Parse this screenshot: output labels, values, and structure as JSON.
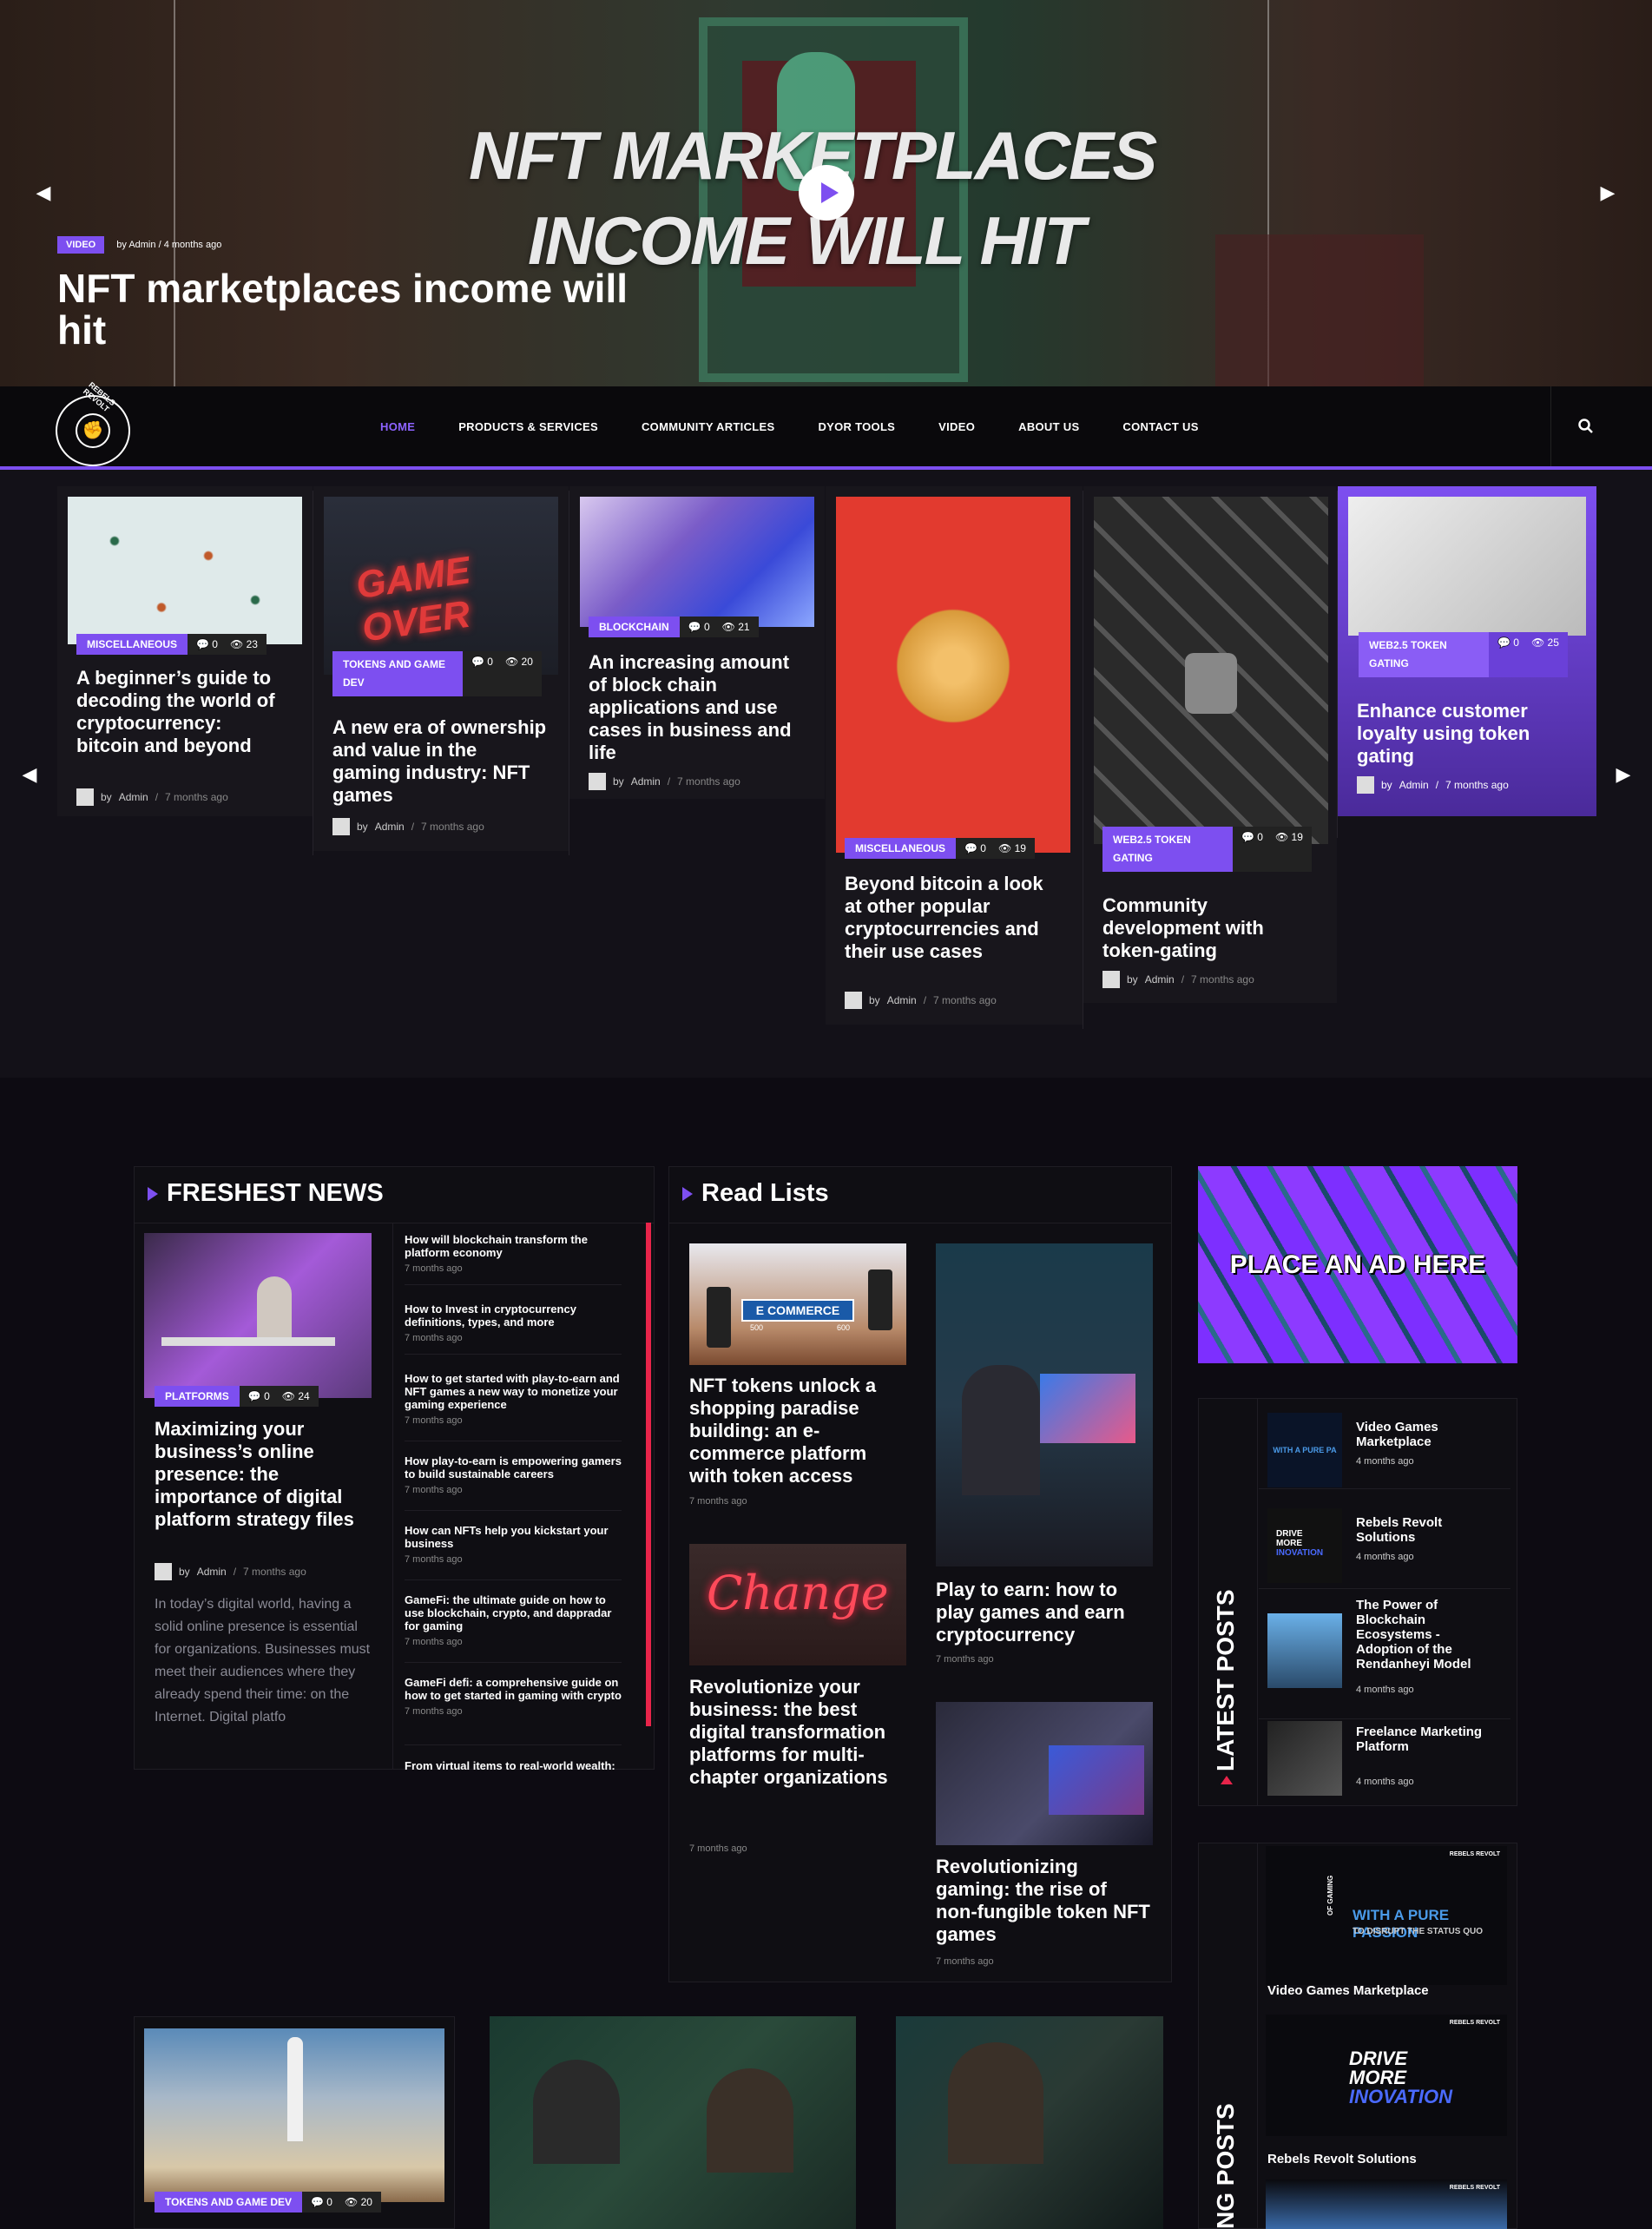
{
  "hero": {
    "overlay_line1": "NFT MARKETPLACES",
    "overlay_line2": "INCOME WILL HIT",
    "badge": "VIDEO",
    "by": "by",
    "author": "Admin",
    "sep": "/",
    "time": "4 months ago",
    "title": "NFT marketplaces income will hit"
  },
  "nav": {
    "logo_text": "REBELS REVOLT",
    "items": [
      "HOME",
      "PRODUCTS & SERVICES",
      "COMMUNITY ARTICLES",
      "DYOR TOOLS",
      "VIDEO",
      "ABOUT US",
      "CONTACT US"
    ],
    "active": "HOME"
  },
  "carousel": {
    "cards": [
      {
        "category": "MISCELLANEOUS",
        "comments": "0",
        "views": "23",
        "title": "A beginner’s guide to decoding the world of cryptocurrency: bitcoin and beyond",
        "by": "by",
        "author": "Admin",
        "time": "7 months ago"
      },
      {
        "category": "TOKENS AND GAME DEV",
        "comments": "0",
        "views": "20",
        "title": "A new era of ownership and value in the gaming industry: NFT games",
        "by": "by",
        "author": "Admin",
        "time": "7 months ago"
      },
      {
        "category": "BLOCKCHAIN",
        "comments": "0",
        "views": "21",
        "title": "An increasing amount of block chain applications and use cases in business and life",
        "by": "by",
        "author": "Admin",
        "time": "7 months ago"
      },
      {
        "category": "MISCELLANEOUS",
        "comments": "0",
        "views": "19",
        "title": "Beyond bitcoin a look at other popular cryptocurrencies and their use cases",
        "by": "by",
        "author": "Admin",
        "time": "7 months ago"
      },
      {
        "category": "WEB2.5 TOKEN GATING",
        "comments": "0",
        "views": "19",
        "title": "Community development with token-gating",
        "by": "by",
        "author": "Admin",
        "time": "7 months ago"
      },
      {
        "category": "WEB2.5 TOKEN GATING",
        "comments": "0",
        "views": "25",
        "title": "Enhance customer loyalty using token gating",
        "by": "by",
        "author": "Admin",
        "time": "7 months ago"
      }
    ]
  },
  "freshest": {
    "title": "FRESHEST NEWS",
    "featured": {
      "category": "PLATFORMS",
      "comments": "0",
      "views": "24",
      "title": "Maximizing your business’s online presence: the importance of digital platform strategy files",
      "by": "by",
      "author": "Admin",
      "time": "7 months ago",
      "excerpt": "In today’s digital world, having a solid online presence is essential for organizations. Businesses must meet their audiences where they already spend their time: on the Internet. Digital platfo"
    },
    "list": [
      {
        "title": "How will blockchain transform the platform economy",
        "time": "7 months ago"
      },
      {
        "title": "How to Invest in cryptocurrency definitions, types, and more",
        "time": "7 months ago"
      },
      {
        "title": "How to get started with play-to-earn and NFT games a new way to monetize your gaming experience",
        "time": "7 months ago"
      },
      {
        "title": "How play-to-earn is empowering gamers to build sustainable careers",
        "time": "7 months ago"
      },
      {
        "title": "How can NFTs help you kickstart your business",
        "time": "7 months ago"
      },
      {
        "title": "GameFi: the ultimate guide on how to use blockchain, crypto, and dappradar for gaming",
        "time": "7 months ago"
      },
      {
        "title": "GameFi defi: a comprehensive guide on how to get started in gaming with crypto",
        "time": "7 months ago"
      },
      {
        "title": "From virtual items to real-world wealth:",
        "time": ""
      }
    ]
  },
  "readlists": {
    "title": "Read Lists",
    "sign_text": "E COMMERCE",
    "sign_num1": "500",
    "sign_num2": "600",
    "neon_text": "Change",
    "items": [
      {
        "title": "NFT tokens unlock a shopping paradise building: an e-commerce platform with token access",
        "time": "7 months ago"
      },
      {
        "title": "Play to earn: how to play games and earn cryptocurrency",
        "time": "7 months ago"
      },
      {
        "title": "Revolutionize your business: the best digital transformation platforms for multi-chapter organizations",
        "time": "7 months ago"
      },
      {
        "title": "Revolutionizing gaming: the rise of non-fungible token NFT games",
        "time": "7 months ago"
      }
    ]
  },
  "ad": {
    "text": "PLACE AN AD HERE"
  },
  "latest": {
    "label": "LATEST POSTS",
    "items": [
      {
        "title": "Video Games Marketplace",
        "time": "4 months ago"
      },
      {
        "title": "Rebels Revolt Solutions",
        "time": "4 months ago"
      },
      {
        "title": "The Power of Blockchain Ecosystems - Adoption of the Rendanheyi Model",
        "time": "4 months ago"
      },
      {
        "title": "Freelance Marketing Platform",
        "time": "4 months ago"
      }
    ],
    "thumb1": "WITH A PURE PA",
    "thumb2_l1": "DRIVE",
    "thumb2_l2": "MORE",
    "thumb2_l3": "INOVATION"
  },
  "trending": {
    "label": "NG POSTS",
    "brand": "REBELS REVOLT",
    "card1": {
      "line_a": "OF GAMING",
      "line_b": "WITH A PURE PASSION",
      "line_c": "TO DISRUPT THE STATUS QUO",
      "title": "Video Games Marketplace"
    },
    "card2": {
      "l1": "DRIVE",
      "l2": "MORE",
      "l3": "INOVATION",
      "title": "Rebels Revolt Solutions"
    }
  },
  "bottom": {
    "category": "TOKENS AND GAME DEV",
    "comments": "0",
    "views": "20"
  }
}
